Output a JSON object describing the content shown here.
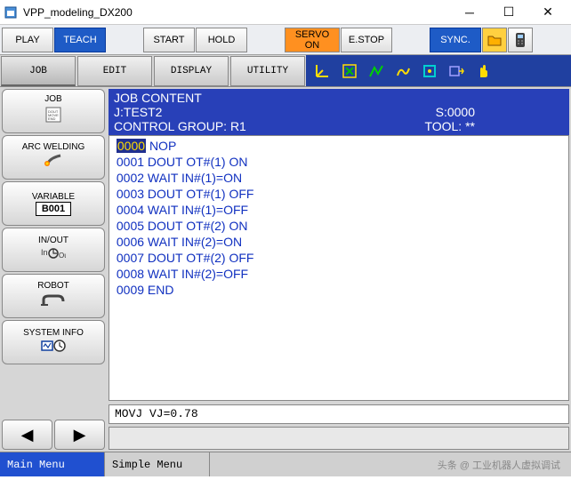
{
  "window": {
    "title": "VPP_modeling_DX200"
  },
  "toolbar1": {
    "play": "PLAY",
    "teach": "TEACH",
    "start": "START",
    "hold": "HOLD",
    "servo": "SERVO ON",
    "estop": "E.STOP",
    "sync": "SYNC."
  },
  "toolbar2": {
    "job": "JOB",
    "edit": "EDIT",
    "display": "DISPLAY",
    "utility": "UTILITY"
  },
  "sidebar": {
    "job": "JOB",
    "job_sub": "DOUT\nMOVE\nEND",
    "arc": "ARC WELDING",
    "variable": "VARIABLE",
    "variable_val": "B001",
    "inout": "IN/OUT",
    "robot": "ROBOT",
    "sysinfo": "SYSTEM INFO"
  },
  "header": {
    "title": "JOB CONTENT",
    "jobname_label": "J:",
    "jobname": "TEST2",
    "step_label": "S:",
    "step": "0000",
    "ctrl_label": "CONTROL GROUP:",
    "ctrl": "R1",
    "tool_label": "TOOL:",
    "tool": "**"
  },
  "program": [
    {
      "num": "0000",
      "instr": "NOP",
      "hl": true
    },
    {
      "num": "0001",
      "instr": "DOUT OT#(1) ON"
    },
    {
      "num": "0002",
      "instr": "WAIT IN#(1)=ON"
    },
    {
      "num": "0003",
      "instr": "DOUT OT#(1) OFF"
    },
    {
      "num": "0004",
      "instr": "WAIT IN#(1)=OFF"
    },
    {
      "num": "0005",
      "instr": "DOUT OT#(2) ON"
    },
    {
      "num": "0006",
      "instr": "WAIT IN#(2)=ON"
    },
    {
      "num": "0007",
      "instr": "DOUT OT#(2) OFF"
    },
    {
      "num": "0008",
      "instr": "WAIT IN#(2)=OFF"
    },
    {
      "num": "0009",
      "instr": "END"
    }
  ],
  "command_line": "MOVJ VJ=0.78",
  "bottom": {
    "main": "Main Menu",
    "simple": "Simple Menu"
  },
  "watermark": "头条 @ 工业机器人虚拟调试"
}
